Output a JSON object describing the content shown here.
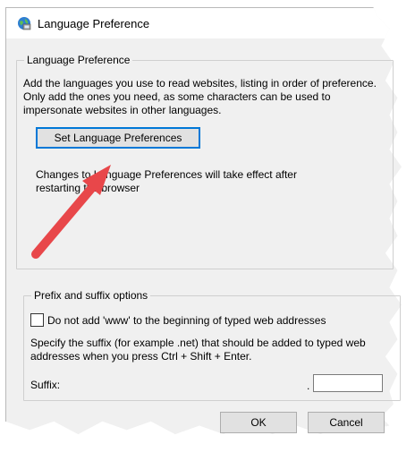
{
  "window": {
    "title": "Language Preference",
    "icon": "internet-options-icon"
  },
  "language_group": {
    "legend": "Language Preference",
    "description": "Add the languages you use to read websites, listing in order of preference. Only add the ones you need, as some characters can be used to impersonate websites in other languages.",
    "button_label": "Set Language Preferences",
    "note": "Changes to Language Preferences will take effect after restarting the browser"
  },
  "prefix_group": {
    "legend": "Prefix and suffix options",
    "checkbox_label": "Do not add 'www' to the beginning of typed web addresses",
    "checkbox_checked": false,
    "suffix_description": "Specify the suffix (for example .net) that should be added to typed web addresses when you press Ctrl + Shift + Enter.",
    "suffix_label": "Suffix:",
    "suffix_dot": ".",
    "suffix_value": ""
  },
  "buttons": {
    "ok": "OK",
    "cancel": "Cancel"
  },
  "annotation": {
    "arrow_color": "#e8474a",
    "arrow_icon": "red-arrow-pointer"
  }
}
